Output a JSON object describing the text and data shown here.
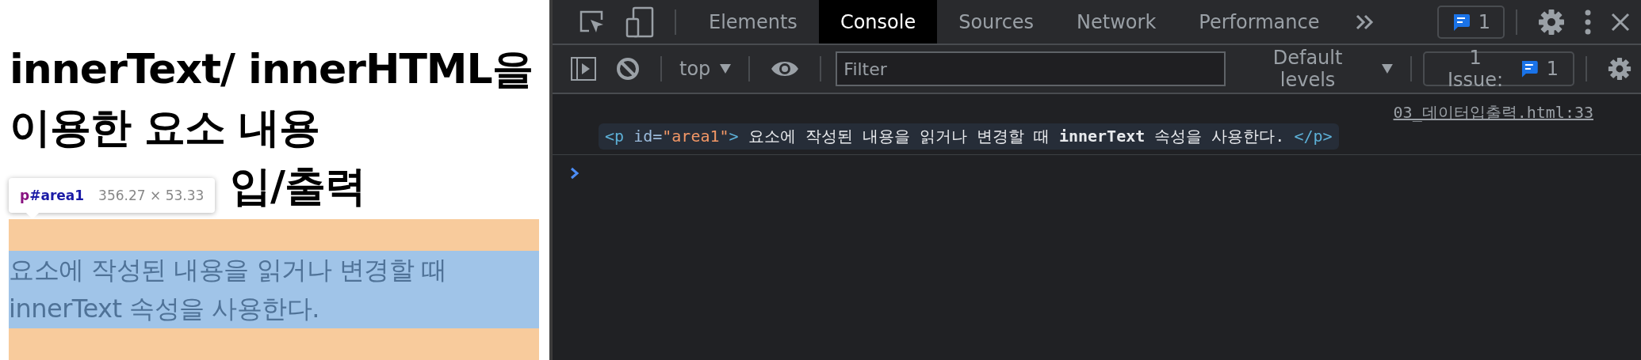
{
  "page": {
    "heading_lines": [
      "innerText/ innerHTML을",
      "이용한 요소 내용",
      "입/출력"
    ],
    "inspect_tooltip": {
      "selector_tag": "p",
      "selector_id": "#area1",
      "size": "356.27 × 53.33"
    },
    "paragraph": "요소에 작성된 내용을 읽거나 변경할 때 innerText 속성을 사용한다."
  },
  "devtools": {
    "tabs": [
      {
        "label": "Elements",
        "selected": false
      },
      {
        "label": "Console",
        "selected": true
      },
      {
        "label": "Sources",
        "selected": false
      },
      {
        "label": "Network",
        "selected": false
      },
      {
        "label": "Performance",
        "selected": false
      }
    ],
    "issues_badge": "1",
    "console_toolbar": {
      "context": "top",
      "filter": {
        "placeholder": "Filter"
      },
      "levels": "Default levels",
      "issues_label": "1 Issue:",
      "issues_count": "1"
    },
    "messages": [
      {
        "source": "03_데이터입출력.html:33",
        "parts": [
          {
            "kind": "tag",
            "text": "<p"
          },
          {
            "kind": "attr",
            "text": " id="
          },
          {
            "kind": "value",
            "text": "\"area1\""
          },
          {
            "kind": "tag",
            "text": ">"
          },
          {
            "kind": "text",
            "text": " 요소에 작성된 내용을 읽거나 변경할 때 **innerText** 속성을 사용한다. "
          },
          {
            "kind": "tag",
            "text": "</p>"
          }
        ]
      }
    ]
  }
}
